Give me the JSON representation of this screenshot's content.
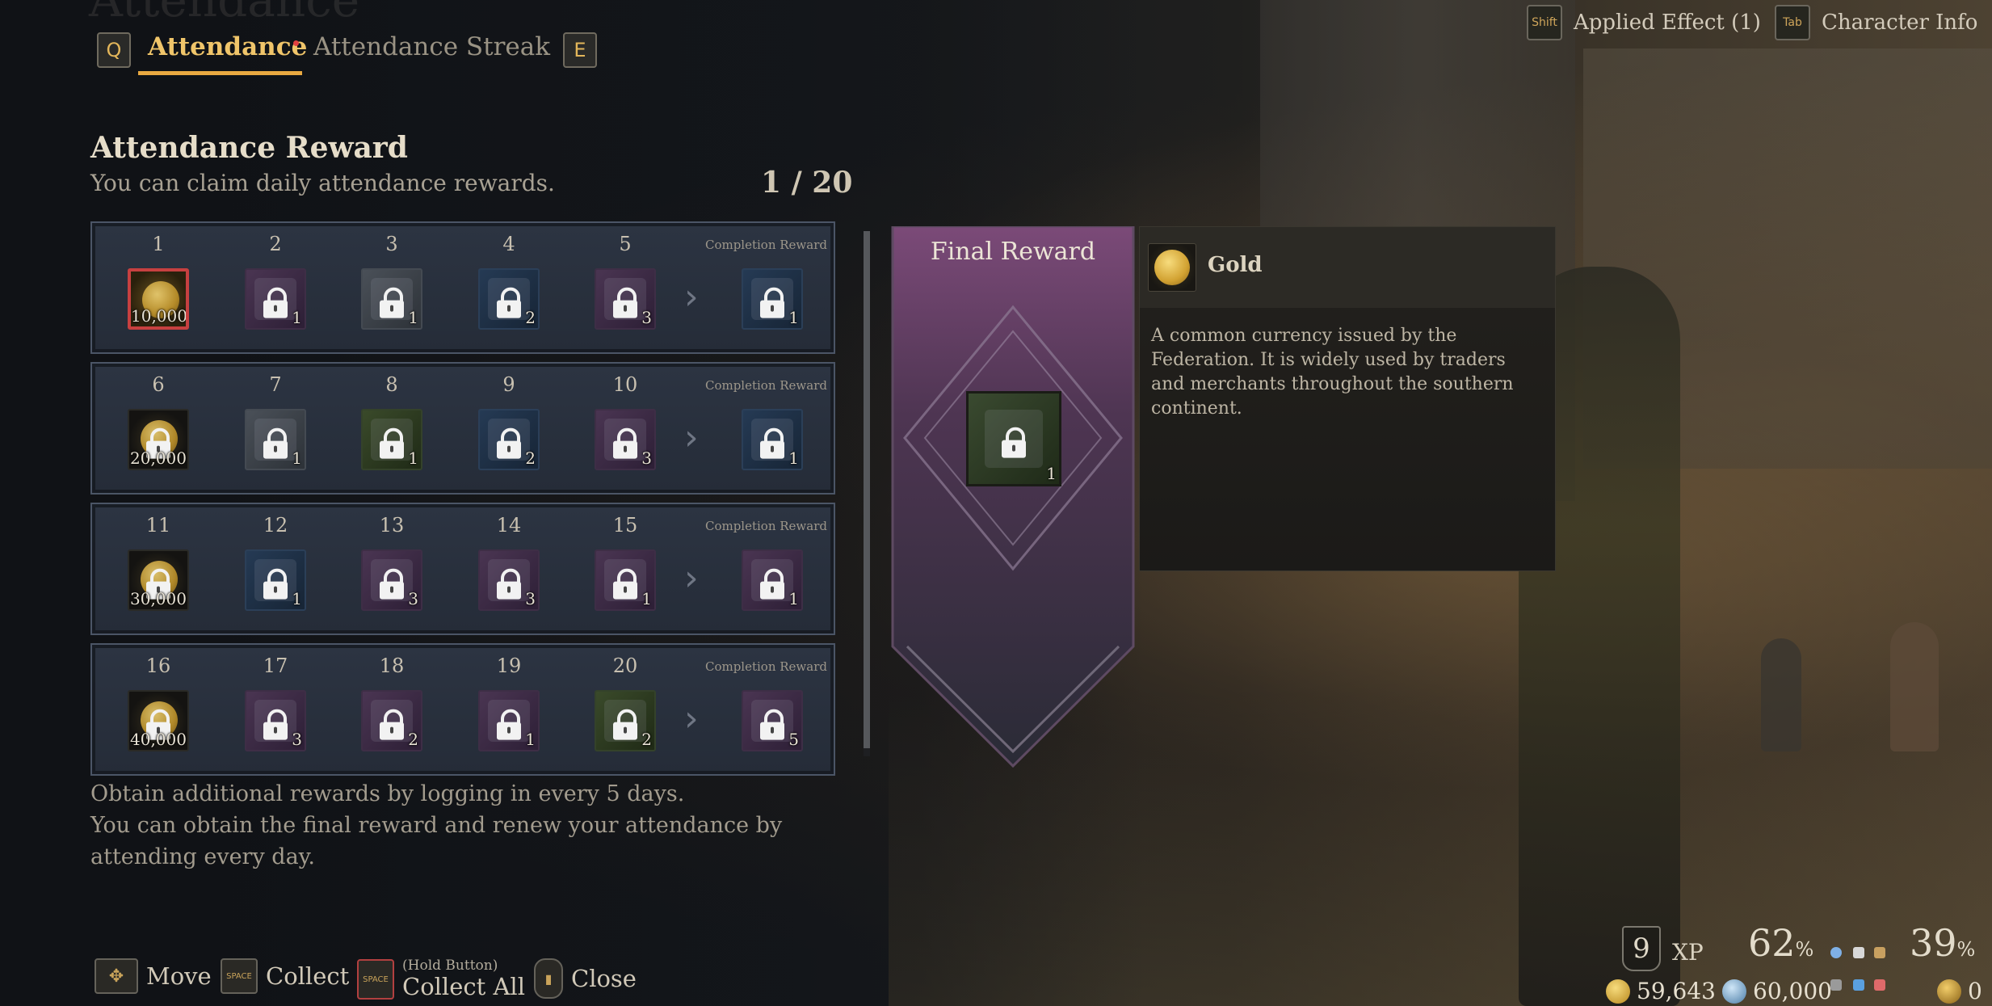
{
  "tabs": {
    "prev_key": "Q",
    "next_key": "E",
    "items": [
      {
        "label": "Attendance",
        "active": true,
        "notification": true
      },
      {
        "label": "Attendance Streak",
        "active": false
      }
    ],
    "ghost_title": "Attendance"
  },
  "top_right": {
    "applied_key": "Shift",
    "applied_label": "Applied Effect (1)",
    "char_key": "Tab",
    "char_label": "Character Info"
  },
  "section": {
    "title": "Attendance Reward",
    "subtitle": "You can claim daily attendance rewards.",
    "progress": "1 / 20"
  },
  "rows": [
    {
      "days": [
        "1",
        "2",
        "3",
        "4",
        "5"
      ],
      "completion_label": "Completion Reward",
      "slots": [
        {
          "type": "gold-active",
          "qty": "10,000",
          "locked": false
        },
        {
          "type": "purple",
          "qty": "1",
          "locked": true
        },
        {
          "type": "gray",
          "qty": "1",
          "locked": true
        },
        {
          "type": "blue",
          "qty": "2",
          "locked": true
        },
        {
          "type": "purple",
          "qty": "3",
          "locked": true
        }
      ],
      "completion": {
        "type": "blue",
        "qty": "1",
        "locked": true
      }
    },
    {
      "days": [
        "6",
        "7",
        "8",
        "9",
        "10"
      ],
      "completion_label": "Completion Reward",
      "slots": [
        {
          "type": "gold",
          "qty": "20,000",
          "locked": true
        },
        {
          "type": "gray",
          "qty": "1",
          "locked": true
        },
        {
          "type": "green",
          "qty": "1",
          "locked": true
        },
        {
          "type": "blue",
          "qty": "2",
          "locked": true
        },
        {
          "type": "purple",
          "qty": "3",
          "locked": true
        }
      ],
      "completion": {
        "type": "blue",
        "qty": "1",
        "locked": true
      }
    },
    {
      "days": [
        "11",
        "12",
        "13",
        "14",
        "15"
      ],
      "completion_label": "Completion Reward",
      "slots": [
        {
          "type": "gold",
          "qty": "30,000",
          "locked": true
        },
        {
          "type": "blue",
          "qty": "1",
          "locked": true
        },
        {
          "type": "purple",
          "qty": "3",
          "locked": true
        },
        {
          "type": "purple",
          "qty": "3",
          "locked": true
        },
        {
          "type": "purple",
          "qty": "1",
          "locked": true
        }
      ],
      "completion": {
        "type": "purple",
        "qty": "1",
        "locked": true
      }
    },
    {
      "days": [
        "16",
        "17",
        "18",
        "19",
        "20"
      ],
      "completion_label": "Completion Reward",
      "slots": [
        {
          "type": "gold",
          "qty": "40,000",
          "locked": true
        },
        {
          "type": "purple",
          "qty": "3",
          "locked": true
        },
        {
          "type": "purple",
          "qty": "2",
          "locked": true
        },
        {
          "type": "purple",
          "qty": "1",
          "locked": true
        },
        {
          "type": "green",
          "qty": "2",
          "locked": true
        }
      ],
      "completion": {
        "type": "purple",
        "qty": "5",
        "locked": true
      }
    }
  ],
  "footer": {
    "line1": "Obtain additional rewards by logging in every 5 days.",
    "line2": "You can obtain the final reward and renew your attendance by",
    "line3": "attending every day."
  },
  "final_reward": {
    "title": "Final Reward",
    "qty": "1",
    "locked": true
  },
  "detail": {
    "name": "Gold",
    "description": "A common currency issued by the Federation. It is widely used by traders and merchants throughout the southern continent."
  },
  "controls": {
    "move_label": "Move",
    "collect_key": "SPACE",
    "collect_label": "Collect",
    "collect_all_key": "SPACE",
    "collect_all_hint": "(Hold Button)",
    "collect_all_label": "Collect All",
    "close_label": "Close"
  },
  "hud": {
    "level": "9",
    "xp_label": "XP",
    "xp_percent": "62",
    "right_percent": "39",
    "percent_sign": "%",
    "gold": "59,643",
    "gems": "60,000",
    "third": "0"
  },
  "colors": {
    "accent": "#e9a941",
    "tab_active": "#f0c56a",
    "notification": "#e24040",
    "selected_border": "#c74040"
  }
}
